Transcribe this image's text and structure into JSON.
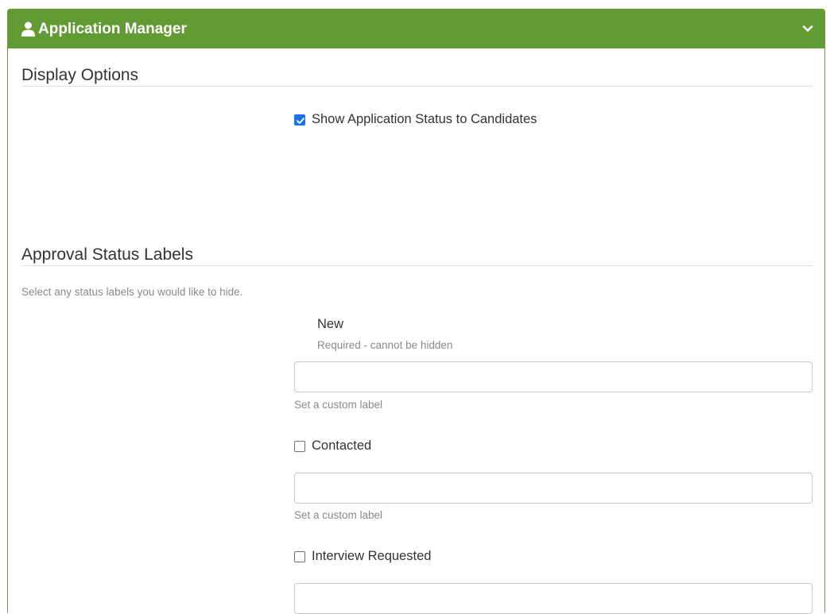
{
  "header": {
    "title": "Application Manager",
    "icon": "user-icon",
    "collapse_icon": "chevron-down-icon",
    "color": "#629a33"
  },
  "display_options": {
    "title": "Display Options",
    "show_status": {
      "label": "Show Application Status to Candidates",
      "checked": true
    }
  },
  "approval": {
    "title": "Approval Status Labels",
    "description": "Select any status labels you would like to hide.",
    "statuses": [
      {
        "label": "New",
        "note": "Required - cannot be hidden",
        "custom_label_value": "",
        "custom_label_hint": "Set a custom label"
      },
      {
        "label": "Contacted",
        "checked": false,
        "custom_label_value": "",
        "custom_label_hint": "Set a custom label"
      },
      {
        "label": "Interview Requested",
        "checked": false,
        "custom_label_value": ""
      }
    ]
  },
  "colors": {
    "accent_checkbox": "#1a73e8",
    "hint_text": "#8a8a8a"
  }
}
